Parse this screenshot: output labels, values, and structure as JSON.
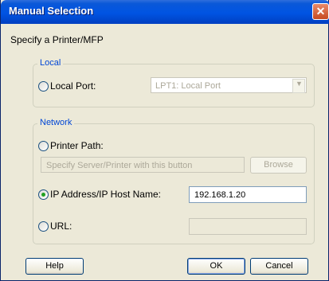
{
  "window": {
    "title": "Manual Selection"
  },
  "prompt": "Specify a Printer/MFP",
  "local": {
    "legend": "Local",
    "local_port_label": "Local Port:",
    "port_value": "LPT1:  Local Port"
  },
  "network": {
    "legend": "Network",
    "printer_path_label": "Printer Path:",
    "path_placeholder": "Specify Server/Printer with this button",
    "browse_label": "Browse",
    "ip_label": "IP Address/IP Host Name:",
    "ip_value": "192.168.1.20",
    "url_label": "URL:",
    "url_value": ""
  },
  "buttons": {
    "help": "Help",
    "ok": "OK",
    "cancel": "Cancel"
  },
  "selected_option": "IP Address/IP Host Name",
  "icons": {
    "close": "close-icon",
    "dropdown": "chevron-down-icon"
  }
}
